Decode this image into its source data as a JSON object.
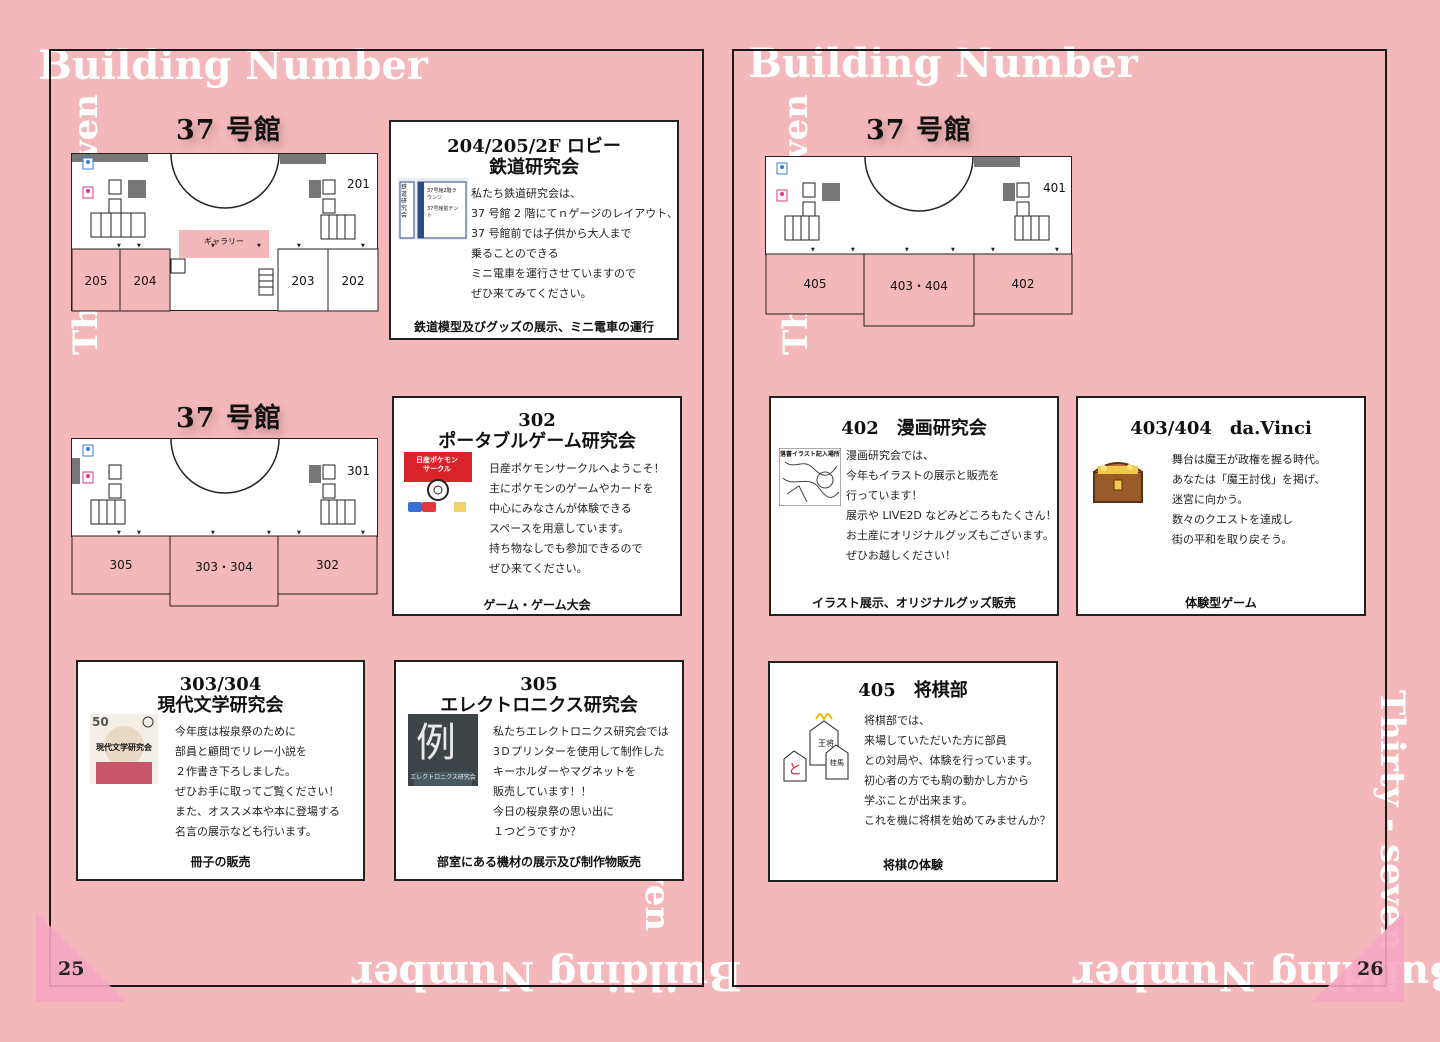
{
  "decor": {
    "building_number": "Building Number",
    "thirty_seven": "Thirty - seven",
    "ven": "ven"
  },
  "left": {
    "page_number": "25",
    "maps": [
      {
        "title": "37 号館",
        "rooms": [
          "205",
          "204",
          "203",
          "202"
        ],
        "side_room": "201",
        "gallery": "ギャラリー"
      },
      {
        "title": "37 号館",
        "rooms": [
          "305",
          "303・304",
          "302"
        ],
        "side_room": "301"
      }
    ],
    "cards": [
      {
        "title_lines": [
          "204/205/2F ロビー",
          "鉄道研究会"
        ],
        "body": [
          "私たち鉄道研究会は、",
          "37 号館 2 階にてｎゲージのレイアウト、",
          "37 号館前では子供から大人まで",
          "乗ることのできる",
          "ミニ電車を運行させていますので",
          "ぜひ来てみてください。"
        ],
        "footer": "鉄道模型及びグッズの展示、ミニ電車の運行",
        "thumb_text": [
          "鉄道研究会",
          "37号館2階ラウンジ",
          "37号館前テント"
        ]
      },
      {
        "title_lines": [
          "302",
          "ポータブルゲーム研究会"
        ],
        "body": [
          "日産ポケモンサークルへようこそ！",
          "主にポケモンのゲームやカードを",
          "中心にみなさんが体験できる",
          "スペースを用意しています。",
          "持ち物なしでも参加できるので",
          "ぜひ来てください。"
        ],
        "footer": "ゲーム・ゲーム大会",
        "thumb_text": [
          "日産ポケモン",
          "サークル"
        ]
      },
      {
        "title_lines": [
          "303/304",
          "現代文学研究会"
        ],
        "body": [
          "今年度は桜泉祭のために",
          "部員と顧問でリレー小説を",
          "２作書き下ろしました。",
          "ぜひお手に取ってご覧ください！",
          "また、オススメ本や本に登場する",
          "名言の展示なども行います。"
        ],
        "footer": "冊子の販売",
        "thumb_text": [
          "50",
          "現代文学研究会"
        ]
      },
      {
        "title_lines": [
          "305",
          "エレクトロニクス研究会"
        ],
        "body": [
          "私たちエレクトロニクス研究会では",
          "3Ｄプリンターを使用して制作した",
          "キーホルダーやマグネットを",
          "販売しています！！",
          "今日の桜泉祭の思い出に",
          "１つどうですか？"
        ],
        "footer": "部室にある機材の展示及び制作物販売",
        "thumb_text": [
          "例",
          "エレクトロニクス研究会"
        ]
      }
    ]
  },
  "right": {
    "page_number": "26",
    "map": {
      "title": "37 号館",
      "rooms": [
        "405",
        "403・404",
        "402"
      ],
      "side_room": "401"
    },
    "cards": [
      {
        "title": "402　漫画研究会",
        "body": [
          "漫画研究会では、",
          "今年もイラストの展示と販売を",
          "行っています！",
          "展示や LIVE2D などみどころもたくさん！",
          "お土産にオリジナルグッズもございます。",
          "ぜひお越しください！"
        ],
        "footer": "イラスト展示、オリジナルグッズ販売",
        "thumb_text": "落書イラスト記入場所"
      },
      {
        "title": "403/404　da.Vinci",
        "body": [
          "舞台は魔王が政権を握る時代。",
          "あなたは「魔王討伐」を掲げ、",
          "迷宮に向かう。",
          "数々のクエストを達成し",
          "街の平和を取り戻そう。"
        ],
        "footer": "体験型ゲーム"
      },
      {
        "title": "405　将棋部",
        "body": [
          "将棋部では、",
          "来場していただいた方に部員",
          "との対局や、体験を行っています。",
          "初心者の方でも駒の動かし方から",
          "学ぶことが出来ます。",
          "これを機に将棋を始めてみませんか？"
        ],
        "footer": "将棋の体験",
        "thumb_text": [
          "王将",
          "桂馬",
          "と"
        ]
      }
    ]
  },
  "colors": {
    "background": "#f5b8ba",
    "room_pink": "#f5b8ba",
    "corner_pink": "#f6a6c4"
  }
}
